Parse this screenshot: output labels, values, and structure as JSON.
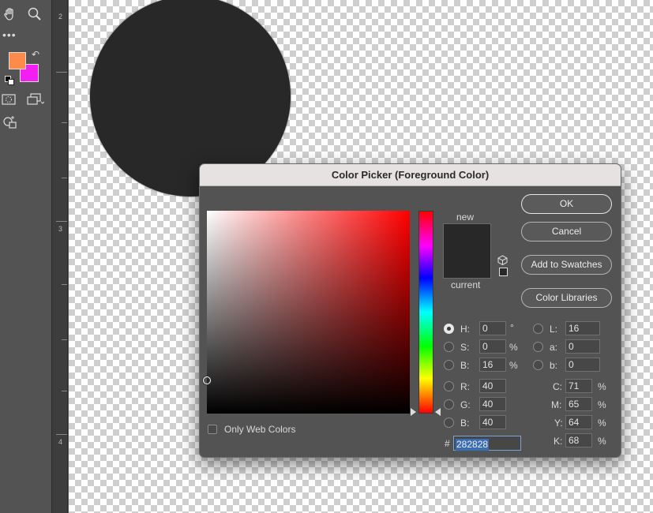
{
  "document": {
    "ruler_numbers": [
      "2",
      "3",
      "4"
    ],
    "shape_color": "#282828"
  },
  "toolbar": {
    "foreground_color": "#FF8A4A",
    "background_color": "#F21EF2",
    "more_label": "•••"
  },
  "dialog": {
    "title": "Color Picker (Foreground Color)",
    "new_label": "new",
    "current_label": "current",
    "new_color": "#282828",
    "current_color": "#282828",
    "buttons": {
      "ok": "OK",
      "cancel": "Cancel",
      "add_to_swatches": "Add to Swatches",
      "color_libraries": "Color Libraries"
    },
    "only_web_colors": "Only Web Colors",
    "hsb": {
      "h_label": "H:",
      "h_value": "0",
      "h_unit": "°",
      "s_label": "S:",
      "s_value": "0",
      "s_unit": "%",
      "b_label": "B:",
      "b_value": "16",
      "b_unit": "%"
    },
    "rgb": {
      "r_label": "R:",
      "r_value": "40",
      "g_label": "G:",
      "g_value": "40",
      "b_label": "B:",
      "b_value": "40"
    },
    "lab": {
      "l_label": "L:",
      "l_value": "16",
      "a_label": "a:",
      "a_value": "0",
      "b_label": "b:",
      "b_value": "0"
    },
    "cmyk": {
      "c_label": "C:",
      "c_value": "71",
      "c_unit": "%",
      "m_label": "M:",
      "m_value": "65",
      "m_unit": "%",
      "y_label": "Y:",
      "y_value": "64",
      "y_unit": "%",
      "k_label": "K:",
      "k_value": "68",
      "k_unit": "%"
    },
    "hex_label": "#",
    "hex_value": "282828",
    "hue_base_color": "#FF0000"
  }
}
